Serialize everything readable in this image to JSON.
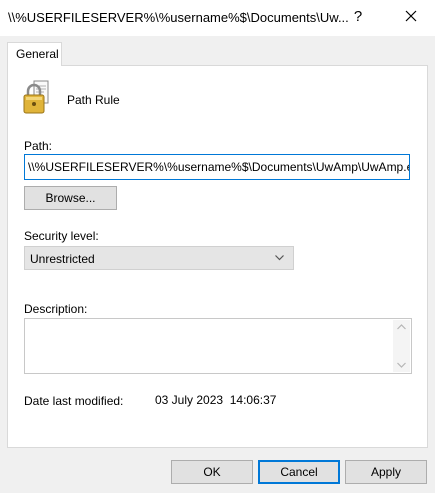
{
  "window": {
    "title": "\\\\%USERFILESERVER%\\%username%$\\Documents\\Uw...",
    "help_label": "?",
    "close_icon": "close-icon"
  },
  "tabs": [
    {
      "label": "General",
      "active": true
    }
  ],
  "rule": {
    "icon": "padlock-document-icon",
    "name": "Path Rule"
  },
  "path": {
    "label": "Path:",
    "value": "\\\\%USERFILESERVER%\\%username%$\\Documents\\UwAmp\\UwAmp.exe",
    "browse_label": "Browse..."
  },
  "security": {
    "label": "Security level:",
    "selected": "Unrestricted"
  },
  "description": {
    "label": "Description:",
    "value": ""
  },
  "date_modified": {
    "label": "Date last modified:",
    "value": "03 July 2023  14:06:37"
  },
  "buttons": {
    "ok": "OK",
    "cancel": "Cancel",
    "apply": "Apply"
  },
  "colors": {
    "accent": "#0078d7",
    "window_bg": "#f0f0f0",
    "panel_bg": "#ffffff"
  }
}
